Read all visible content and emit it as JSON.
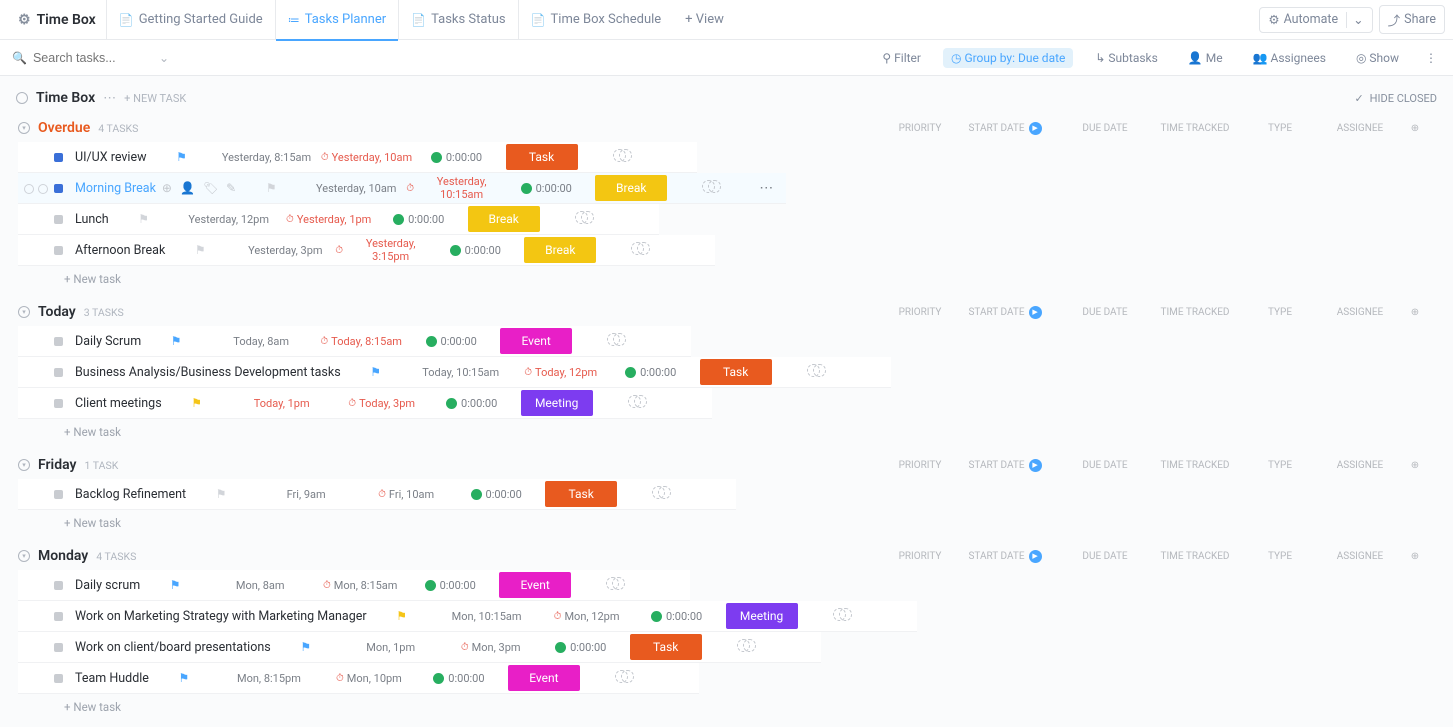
{
  "header": {
    "space_title": "Time Box",
    "tabs": [
      {
        "label": "Getting Started Guide",
        "active": false
      },
      {
        "label": "Tasks Planner",
        "active": true
      },
      {
        "label": "Tasks Status",
        "active": false
      },
      {
        "label": "Time Box Schedule",
        "active": false
      }
    ],
    "add_view": "+ View",
    "automate": "Automate",
    "share": "Share"
  },
  "filterbar": {
    "search_placeholder": "Search tasks...",
    "filter": "Filter",
    "group_by": "Group by: Due date",
    "subtasks": "Subtasks",
    "me": "Me",
    "assignees": "Assignees",
    "show": "Show"
  },
  "listhead": {
    "title": "Time Box",
    "new_task": "+ NEW TASK",
    "hide_closed": "HIDE CLOSED"
  },
  "columns": {
    "priority": "PRIORITY",
    "start": "START DATE",
    "due": "DUE DATE",
    "tracked": "TIME TRACKED",
    "type": "TYPE",
    "assignee": "ASSIGNEE"
  },
  "groups": [
    {
      "name": "Overdue",
      "name_color": "#e85a1f",
      "count": "4 TASKS",
      "tasks": [
        {
          "name": "UI/UX review",
          "status": "blue",
          "flag": "blue",
          "start": "Yesterday, 8:15am",
          "due": "Yesterday, 10am",
          "due_red": true,
          "tracked": "0:00:00",
          "type": "Task",
          "type_class": "type-task"
        },
        {
          "name": "Morning Break",
          "status": "blue",
          "link": true,
          "hov": true,
          "flag": "grey",
          "start": "Yesterday, 10am",
          "due": "Yesterday, 10:15am",
          "due_red": true,
          "tracked": "0:00:00",
          "type": "Break",
          "type_class": "type-break",
          "show_icons": true,
          "show_more": true
        },
        {
          "name": "Lunch",
          "status": "grey",
          "flag": "grey",
          "start": "Yesterday, 12pm",
          "due": "Yesterday, 1pm",
          "due_red": true,
          "tracked": "0:00:00",
          "type": "Break",
          "type_class": "type-break"
        },
        {
          "name": "Afternoon Break",
          "status": "grey",
          "flag": "grey",
          "start": "Yesterday, 3pm",
          "due": "Yesterday, 3:15pm",
          "due_red": true,
          "tracked": "0:00:00",
          "type": "Break",
          "type_class": "type-break"
        }
      ]
    },
    {
      "name": "Today",
      "name_color": "#2a2e34",
      "count": "3 TASKS",
      "tasks": [
        {
          "name": "Daily Scrum",
          "status": "grey",
          "flag": "blue",
          "start": "Today, 8am",
          "due": "Today, 8:15am",
          "due_red": true,
          "tracked": "0:00:00",
          "type": "Event",
          "type_class": "type-event"
        },
        {
          "name": "Business Analysis/Business Development tasks",
          "status": "grey",
          "flag": "blue",
          "start": "Today, 10:15am",
          "due": "Today, 12pm",
          "due_red": true,
          "tracked": "0:00:00",
          "type": "Task",
          "type_class": "type-task"
        },
        {
          "name": "Client meetings",
          "status": "grey",
          "flag": "yellow",
          "start": "Today, 1pm",
          "start_red": true,
          "due": "Today, 3pm",
          "due_red": true,
          "tracked": "0:00:00",
          "type": "Meeting",
          "type_class": "type-meeting"
        }
      ]
    },
    {
      "name": "Friday",
      "name_color": "#2a2e34",
      "count": "1 TASK",
      "tasks": [
        {
          "name": "Backlog Refinement",
          "status": "grey",
          "flag": "grey",
          "start": "Fri, 9am",
          "due": "Fri, 10am",
          "tracked": "0:00:00",
          "type": "Task",
          "type_class": "type-task"
        }
      ]
    },
    {
      "name": "Monday",
      "name_color": "#2a2e34",
      "count": "4 TASKS",
      "tasks": [
        {
          "name": "Daily scrum",
          "status": "grey",
          "flag": "blue",
          "start": "Mon, 8am",
          "due": "Mon, 8:15am",
          "tracked": "0:00:00",
          "type": "Event",
          "type_class": "type-event"
        },
        {
          "name": "Work on Marketing Strategy with Marketing Manager",
          "status": "grey",
          "flag": "yellow",
          "start": "Mon, 10:15am",
          "due": "Mon, 12pm",
          "tracked": "0:00:00",
          "type": "Meeting",
          "type_class": "type-meeting"
        },
        {
          "name": "Work on client/board presentations",
          "status": "grey",
          "flag": "blue",
          "start": "Mon, 1pm",
          "due": "Mon, 3pm",
          "tracked": "0:00:00",
          "type": "Task",
          "type_class": "type-task"
        },
        {
          "name": "Team Huddle",
          "status": "grey",
          "flag": "blue",
          "start": "Mon, 8:15pm",
          "due": "Mon, 10pm",
          "tracked": "0:00:00",
          "type": "Event",
          "type_class": "type-event"
        }
      ]
    }
  ],
  "new_task_label": "+ New task"
}
